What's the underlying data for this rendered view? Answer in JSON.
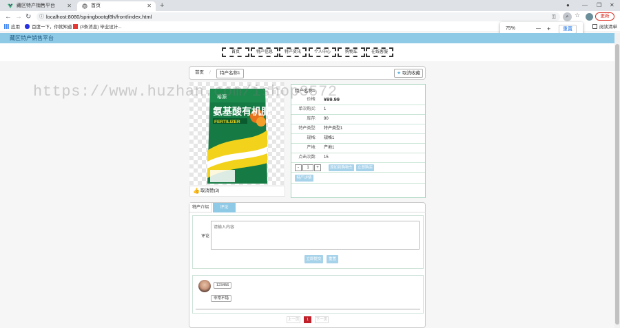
{
  "browser": {
    "tabs": [
      {
        "title": "藏区特产销售平台",
        "active": false
      },
      {
        "title": "首页",
        "active": true
      }
    ],
    "url": "localhost:8080/springbootqf8h/front/index.html",
    "update_label": "更新",
    "bookmarks": [
      "应用",
      "百度一下，你就知道",
      "(3条消息) 毕业设计..."
    ],
    "reading_list": "阅读清单",
    "zoom": {
      "level": "75%",
      "minus": "—",
      "plus": "+",
      "reset": "重置"
    }
  },
  "site": {
    "title": "藏区特产销售平台",
    "nav": [
      "首页",
      "特产信息",
      "特产资讯",
      "个人中心",
      "购物车",
      "在线客服"
    ]
  },
  "breadcrumb": {
    "home": "首页",
    "sep": "/",
    "current": "特产名称1"
  },
  "favorite_label": "取消收藏",
  "favorite_icon": "★",
  "product": {
    "image_text": {
      "brand": "裕源",
      "name": "氨基酸有机肥",
      "sub": "FERTILIZER"
    },
    "title": "特产名称1",
    "price_label": "价格:",
    "price": "¥99.99",
    "rows": [
      {
        "k": "单次购买:",
        "v": "1"
      },
      {
        "k": "库存:",
        "v": "90"
      },
      {
        "k": "特产类型:",
        "v": "特产类型1"
      },
      {
        "k": "规格:",
        "v": "规格1"
      },
      {
        "k": "产地:",
        "v": "产地1"
      },
      {
        "k": "点击次数:",
        "v": "15"
      }
    ],
    "qty": {
      "minus": "-",
      "value": "1",
      "plus": "+"
    },
    "add_cart": "添加到购物车",
    "buy_now": "立即购买",
    "detail_btn": "特产详情",
    "like_label": "取消赞(3)"
  },
  "tabs": {
    "intro": "特产介绍",
    "comment": "评论"
  },
  "comment_form": {
    "label": "评论",
    "placeholder": "请输入内容",
    "submit": "立即提交",
    "reset": "重置"
  },
  "review": {
    "user": "123456",
    "text": "非常不错"
  },
  "pager": {
    "prev": "上一页",
    "page": "1",
    "next": "下一页"
  },
  "watermark": "https://www.huzhan.com/ishop3572",
  "colors": {
    "header": "#8ec9e6",
    "accent": "#a6d2ea",
    "page_active": "#c0202a"
  }
}
